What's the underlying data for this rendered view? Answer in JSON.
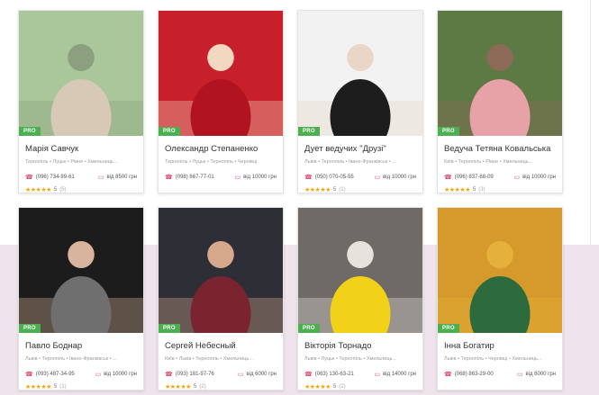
{
  "pro_label": "PRO",
  "currency_prefix": "від",
  "cards": [
    {
      "name": "Марія Савчук",
      "cities": "Тернопіль • Луцьк • Рівне • Хмельниць...",
      "phone": "(096) 734-99-61",
      "price": "від 8500 грн",
      "stars": "★★★★★",
      "rating": "5",
      "reviews": "(5)",
      "photo": {
        "bg": "#a9c79a",
        "fg": "#d8c8b6",
        "accent": "#8aa07f"
      }
    },
    {
      "name": "Олександр Степаненко",
      "cities": "Тернопіль • Луцьк • Тернопіль • Чернівці",
      "phone": "(098) 667-77-01",
      "price": "від 10000 грн",
      "stars": "",
      "rating": "",
      "reviews": "",
      "photo": {
        "bg": "#c8202a",
        "fg": "#b11420",
        "accent": "#f2d8c0"
      }
    },
    {
      "name": "Дует ведучих \"Друзі\"",
      "cities": "Львів • Тернопіль • Івано-Франківськ • ...",
      "phone": "(050) 070-05-55",
      "price": "від 10000 грн",
      "stars": "★★★★★",
      "rating": "5",
      "reviews": "(1)",
      "photo": {
        "bg": "#f2f2f2",
        "fg": "#1d1d1d",
        "accent": "#e9d6c6"
      }
    },
    {
      "name": "Ведуча Тетяна Ковальська",
      "cities": "Київ • Тернопіль • Рівне • Хмельниць...",
      "phone": "(096) 837-68-09",
      "price": "від 10000 грн",
      "stars": "★★★★★",
      "rating": "5",
      "reviews": "(3)",
      "photo": {
        "bg": "#5d7a45",
        "fg": "#e7a2a8",
        "accent": "#8d6a58"
      }
    },
    {
      "name": "Павло Боднар",
      "cities": "Львів • Тернопіль • Івано-Франківськ • ...",
      "phone": "(093) 487-34-95",
      "price": "від 10000 грн",
      "stars": "★★★★★",
      "rating": "5",
      "reviews": "(1)",
      "photo": {
        "bg": "#1c1c1c",
        "fg": "#6f6f6f",
        "accent": "#d9b49c"
      }
    },
    {
      "name": "Сергей Небесный",
      "cities": "Київ • Львів • Тернопіль • Хмельниць...",
      "phone": "(093) 181-97-76",
      "price": "від 6000 грн",
      "stars": "★★★★★",
      "rating": "5",
      "reviews": "(2)",
      "photo": {
        "bg": "#2e2f36",
        "fg": "#7a2430",
        "accent": "#d6a98c"
      }
    },
    {
      "name": "Вікторія Торнадо",
      "cities": "Львів • Луцьк • Тернопіль • Хмельниць...",
      "phone": "(063) 130-63-21",
      "price": "від 14000 грн",
      "stars": "★★★★★",
      "rating": "5",
      "reviews": "(2)",
      "photo": {
        "bg": "#6f6a66",
        "fg": "#f1d219",
        "accent": "#e8e2dc"
      }
    },
    {
      "name": "Інна Богатир",
      "cities": "Львів • Тернопіль • Чернівці • Хмельниць...",
      "phone": "(068) 863-29-00",
      "price": "від 8000 грн",
      "stars": "",
      "rating": "",
      "reviews": "",
      "photo": {
        "bg": "#d69a2c",
        "fg": "#2d6a3c",
        "accent": "#e6b13a"
      }
    }
  ]
}
